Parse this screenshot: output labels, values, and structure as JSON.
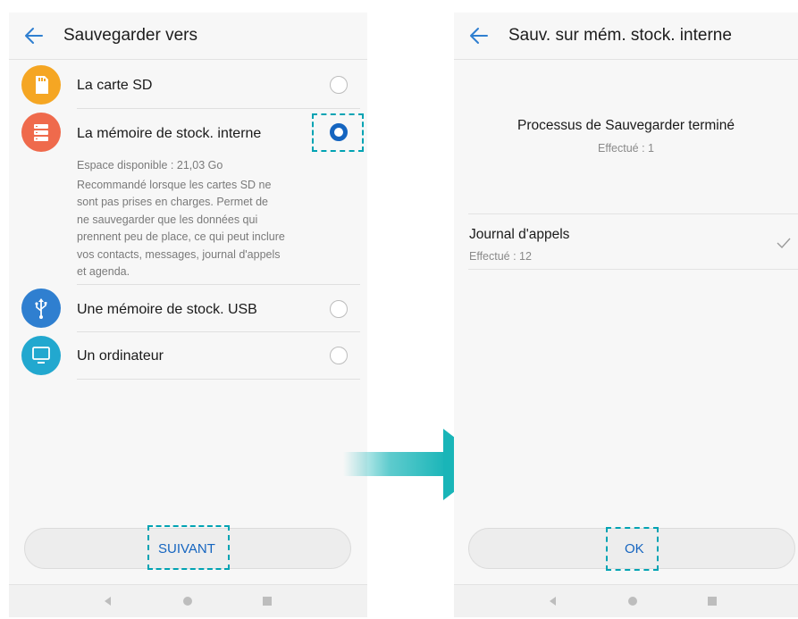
{
  "left": {
    "title": "Sauvegarder vers",
    "options": [
      {
        "label": "La carte SD",
        "icon": "sd-card-icon",
        "color": "#f5a623",
        "selected": false
      },
      {
        "label": "La mémoire de stock. interne",
        "icon": "storage-icon",
        "color": "#ef6a4c",
        "selected": true
      },
      {
        "label": "Une mémoire de stock. USB",
        "icon": "usb-icon",
        "color": "#2f7fd0",
        "selected": false
      },
      {
        "label": "Un ordinateur",
        "icon": "computer-icon",
        "color": "#22a8cf",
        "selected": false
      }
    ],
    "description_lines": [
      "Espace disponible : 21,03  Go",
      "Recommandé lorsque les cartes SD ne",
      "sont pas prises en charges. Permet de",
      "ne sauvegarder que les données qui",
      "prennent peu de place, ce qui peut inclure",
      "vos contacts, messages, journal d'appels",
      "et agenda."
    ],
    "next_label": "SUIVANT"
  },
  "right": {
    "title": "Sauv. sur mém. stock. interne",
    "status_title": "Processus de Sauvegarder terminé",
    "status_count": "Effectué : 1",
    "item_title": "Journal d'appels",
    "item_count": "Effectué : 12",
    "ok_label": "OK"
  },
  "colors": {
    "accent": "#1565c0",
    "highlight": "#00a3b3",
    "arrow": "#19b5b8"
  }
}
